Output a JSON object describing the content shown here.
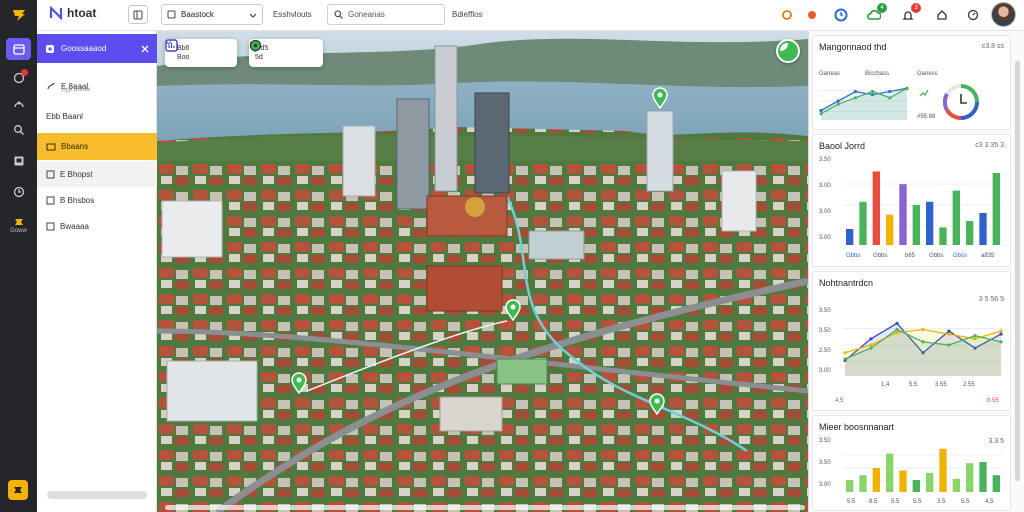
{
  "app": {
    "name": "htoat"
  },
  "rail": {
    "bottom_label": "Goww"
  },
  "topbar": {
    "dropdown_value": "Baastock",
    "link_text": "Esshvlouts",
    "search_placeholder": "Goneanas",
    "filter_text": "Bdiefflos",
    "badges": [
      "4",
      "3"
    ]
  },
  "sidebar": {
    "header": "Goossaaaod",
    "items": [
      {
        "label": "E 8aaal",
        "sub": "Gyp Bhhav"
      },
      {
        "label": "Ebb Baanl"
      },
      {
        "label": "Bbaans"
      },
      {
        "label": "E Bhopst"
      },
      {
        "label": "B Bhsbos"
      },
      {
        "label": "Bwaaaa"
      }
    ]
  },
  "map": {
    "card1": {
      "line1": "Bb6",
      "line2": "Boo"
    },
    "card2": {
      "line1": "Gd5",
      "line2": "5d"
    }
  },
  "panels": [
    {
      "title": "Mangonnaod thd",
      "meta": "c3.8 ss",
      "legend": [
        "Ganeas",
        "Bicchass",
        "Ganess"
      ],
      "note": "#95.88",
      "chart_data": {
        "type": "line",
        "x": [
          1,
          2,
          3,
          4,
          5,
          6
        ],
        "series": [
          {
            "color": "#2f73c9",
            "values": [
              3,
              6,
              9,
              8,
              9,
              10
            ]
          },
          {
            "color": "#48b35a",
            "values": [
              2,
              5,
              7,
              9,
              7,
              10
            ]
          }
        ],
        "ylim": [
          0,
          12
        ]
      }
    },
    {
      "title": "Baool Jorrd",
      "meta": "c3 3.35 3",
      "yticks": [
        "3.50",
        "3.00",
        "3.00",
        "3.00"
      ],
      "xticks": [
        "Gbbs",
        "Gbbs",
        "b65",
        "Gbbs",
        "Gbss",
        "a835"
      ],
      "chart_data": {
        "type": "bar",
        "colors": [
          "#2f63c9",
          "#48b35a",
          "#e94c3d",
          "#f0b400",
          "#8a63d2",
          "#48b35a",
          "#2f63c9",
          "#48b35a",
          "#48b35a",
          "#48b35a",
          "#2f63c9",
          "#48b35a"
        ],
        "values": [
          1.0,
          2.7,
          4.6,
          1.9,
          3.8,
          2.5,
          2.7,
          1.1,
          3.4,
          1.5,
          2.0,
          4.5
        ],
        "ylim": [
          0,
          5
        ]
      }
    },
    {
      "title": "Nohtnantrdcn",
      "meta": "3 5 56 5",
      "yticks": [
        "3.50",
        "3.50",
        "2.50",
        "3.00"
      ],
      "xticks": [
        "4.5",
        "1.4",
        "5.5",
        "3.55",
        "2.55",
        "8.55"
      ],
      "chart_data": {
        "type": "line",
        "x": [
          1,
          2,
          3,
          4,
          5,
          6,
          7
        ],
        "series": [
          {
            "color": "#2f4bc9",
            "values": [
              1.0,
              2.4,
              3.4,
              1.5,
              2.9,
              1.8,
              2.7
            ]
          },
          {
            "color": "#f0b400",
            "values": [
              1.5,
              2.0,
              2.8,
              3.0,
              2.7,
              2.4,
              2.9
            ]
          },
          {
            "color": "#48b35a",
            "values": [
              1.1,
              1.8,
              3.0,
              2.2,
              2.0,
              2.6,
              2.2
            ]
          }
        ],
        "ylim": [
          0,
          4
        ]
      }
    },
    {
      "title": "Mieer boosnnanart",
      "meta": "3.3 5",
      "yticks": [
        "3.50",
        "3.50",
        "3.00"
      ],
      "xticks": [
        "5.5",
        "8.5",
        "5.5",
        "5.5",
        "3.5",
        "5.5",
        "4.5"
      ],
      "chart_data": {
        "type": "bar",
        "colors": [
          "#8bd46a",
          "#8bd46a",
          "#f0b400",
          "#8bd46a",
          "#f0b400",
          "#48b35a",
          "#8bd46a",
          "#f0b400",
          "#8bd46a",
          "#8bd46a",
          "#48b35a",
          "#48b35a"
        ],
        "values": [
          1.0,
          1.4,
          2.0,
          3.2,
          1.8,
          1.0,
          1.6,
          3.6,
          1.1,
          2.4,
          2.5,
          1.4
        ],
        "ylim": [
          0,
          4
        ]
      }
    }
  ]
}
